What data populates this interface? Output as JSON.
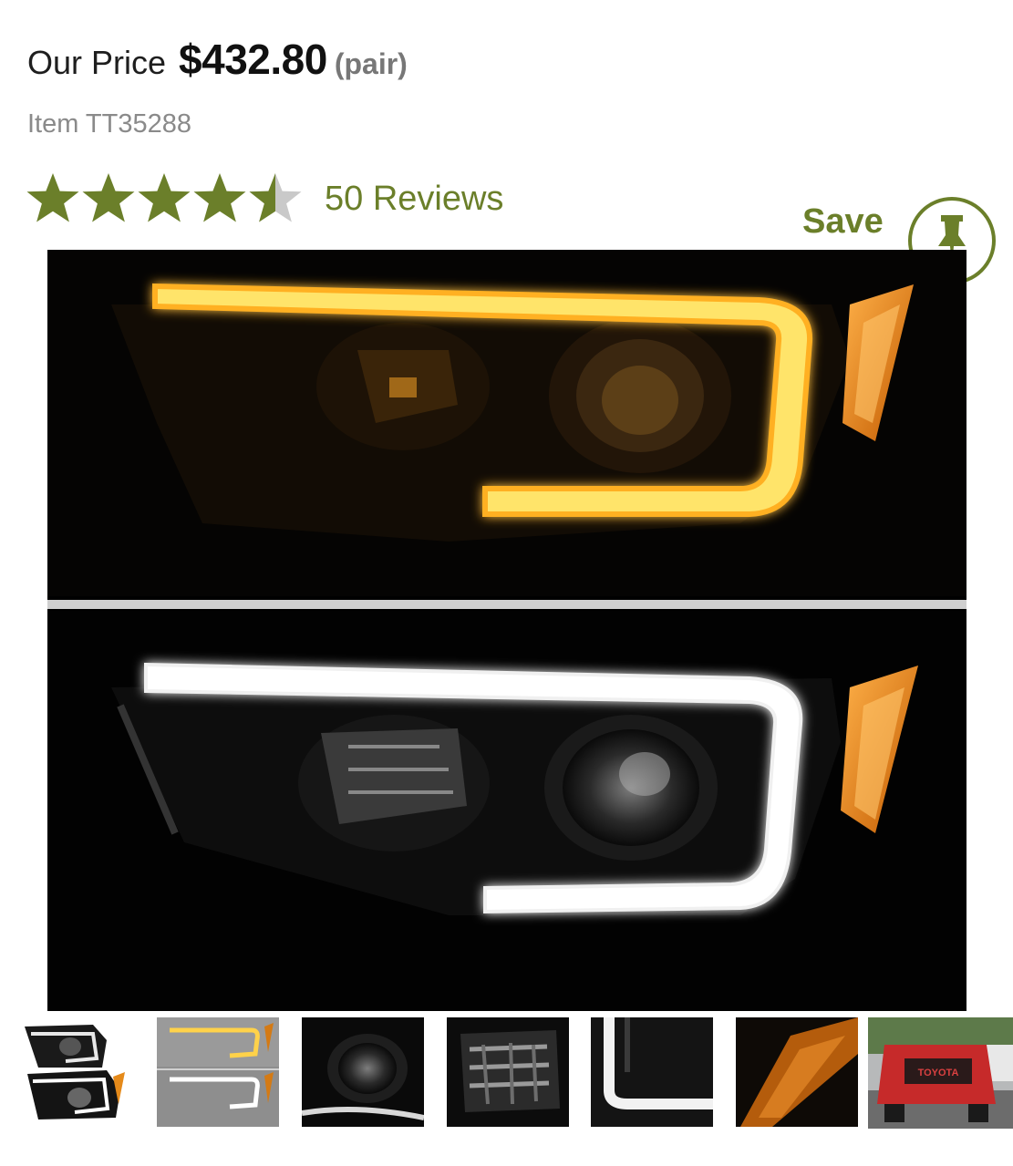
{
  "price": {
    "label": "Our Price",
    "amount": "$432.80",
    "unit": "(pair)"
  },
  "item": {
    "text": "Item TT35288"
  },
  "rating": {
    "stars": 4.5,
    "max_stars": 5,
    "reviews_text": "50 Reviews"
  },
  "save": {
    "label": "Save",
    "icon": "pin-icon"
  },
  "gallery": {
    "main_image": "projector-headlights-amber-and-white-drl",
    "thumbnails": [
      "headlight-pair-thumbnail",
      "amber-white-drl-thumbnail",
      "projector-lens-thumbnail",
      "reflector-thumbnail",
      "light-bar-thumbnail",
      "amber-corner-light-thumbnail",
      "red-truck-thumbnail"
    ]
  },
  "truck_grille_text": "TOYOTA",
  "colors": {
    "accent": "#6b7f2a",
    "star_filled": "#6b7f2a",
    "star_empty": "#c9c9c9",
    "amber_drl": "#ffb020",
    "white_drl": "#ffffff"
  }
}
